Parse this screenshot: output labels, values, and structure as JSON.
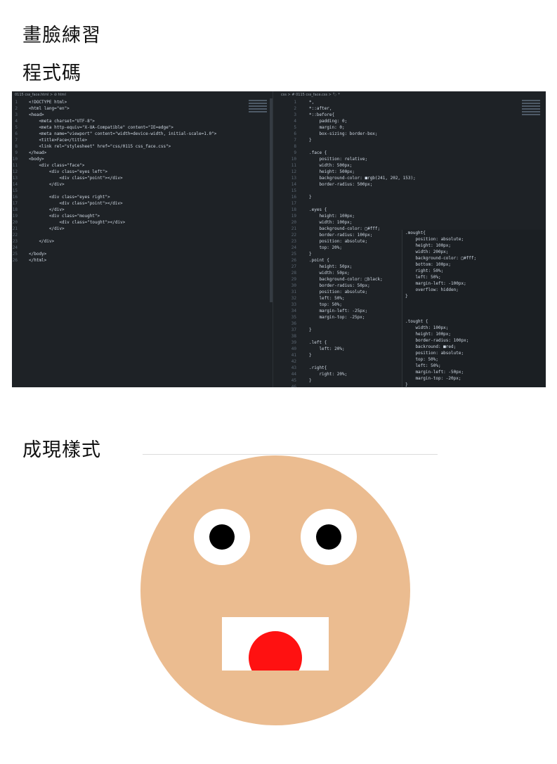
{
  "headings": {
    "practice": "畫臉練習",
    "code": "程式碼",
    "result": "成現樣式"
  },
  "editor": {
    "html_tab": "0115 css_face.html > ⊘ html",
    "css_tab": "css > # 0115 css_face.css > 🏷 *",
    "html_lines": [
      {
        "n": "1",
        "t": "<!DOCTYPE html>"
      },
      {
        "n": "2",
        "t": "<html lang=\"en\">"
      },
      {
        "n": "3",
        "t": "<head>"
      },
      {
        "n": "4",
        "t": "    <meta charset=\"UTF-8\">"
      },
      {
        "n": "5",
        "t": "    <meta http-equiv=\"X-UA-Compatible\" content=\"IE=edge\">"
      },
      {
        "n": "6",
        "t": "    <meta name=\"viewport\" content=\"width=device-width, initial-scale=1.0\">"
      },
      {
        "n": "7",
        "t": "    <title>Face</title>"
      },
      {
        "n": "8",
        "t": "    <link rel=\"stylesheet\" href=\"css/0115 css_face.css\">"
      },
      {
        "n": "9",
        "t": "</head>"
      },
      {
        "n": "10",
        "t": "<body>"
      },
      {
        "n": "11",
        "t": "    <div class=\"face\">"
      },
      {
        "n": "12",
        "t": "        <div class=\"eyes left\">"
      },
      {
        "n": "13",
        "t": "            <div class=\"point\"></div>"
      },
      {
        "n": "14",
        "t": "        </div>"
      },
      {
        "n": "15",
        "t": ""
      },
      {
        "n": "16",
        "t": "        <div class=\"eyes right\">"
      },
      {
        "n": "17",
        "t": "            <div class=\"point\"></div>"
      },
      {
        "n": "18",
        "t": "        </div>"
      },
      {
        "n": "19",
        "t": "        <div class=\"mought\">"
      },
      {
        "n": "20",
        "t": "            <div class=\"tought\"></div>"
      },
      {
        "n": "21",
        "t": "        </div>"
      },
      {
        "n": "22",
        "t": ""
      },
      {
        "n": "23",
        "t": "    </div>"
      },
      {
        "n": "24",
        "t": ""
      },
      {
        "n": "25",
        "t": "</body>"
      },
      {
        "n": "26",
        "t": "</html>"
      }
    ],
    "css_lines": [
      {
        "n": "1",
        "t": "*,"
      },
      {
        "n": "2",
        "t": "*::after,"
      },
      {
        "n": "3",
        "t": "*::before{"
      },
      {
        "n": "4",
        "t": "    padding: 0;"
      },
      {
        "n": "5",
        "t": "    margin: 0;"
      },
      {
        "n": "6",
        "t": "    box-sizing: border-box;"
      },
      {
        "n": "7",
        "t": "}"
      },
      {
        "n": "8",
        "t": ""
      },
      {
        "n": "9",
        "t": ".face {"
      },
      {
        "n": "10",
        "t": "    position: relative;"
      },
      {
        "n": "11",
        "t": "    width: 500px;"
      },
      {
        "n": "12",
        "t": "    height: 500px;"
      },
      {
        "n": "13",
        "t": "    background-color: ■rgb(241, 202, 153);"
      },
      {
        "n": "14",
        "t": "    border-radius: 500px;"
      },
      {
        "n": "15",
        "t": ""
      },
      {
        "n": "16",
        "t": "}"
      },
      {
        "n": "17",
        "t": ""
      },
      {
        "n": "18",
        "t": ".eyes {"
      },
      {
        "n": "19",
        "t": "    height: 100px;"
      },
      {
        "n": "20",
        "t": "    width: 100px;"
      },
      {
        "n": "21",
        "t": "    background-color: □#fff;"
      },
      {
        "n": "22",
        "t": "    border-radius: 100px;"
      },
      {
        "n": "23",
        "t": "    position: absolute;"
      },
      {
        "n": "24",
        "t": "    top: 20%;"
      },
      {
        "n": "25",
        "t": "}"
      },
      {
        "n": "26",
        "t": ".point {"
      },
      {
        "n": "27",
        "t": "    height: 50px;"
      },
      {
        "n": "28",
        "t": "    width: 50px;"
      },
      {
        "n": "29",
        "t": "    background-color: □black;"
      },
      {
        "n": "30",
        "t": "    border-radius: 50px;"
      },
      {
        "n": "31",
        "t": "    position: absolute;"
      },
      {
        "n": "32",
        "t": "    left: 50%;"
      },
      {
        "n": "33",
        "t": "    top: 50%;"
      },
      {
        "n": "34",
        "t": "    margin-left: -25px;"
      },
      {
        "n": "35",
        "t": "    margin-top: -25px;"
      },
      {
        "n": "36",
        "t": ""
      },
      {
        "n": "37",
        "t": "}"
      },
      {
        "n": "38",
        "t": ""
      },
      {
        "n": "39",
        "t": ".left {"
      },
      {
        "n": "40",
        "t": "    left: 20%;"
      },
      {
        "n": "41",
        "t": "}"
      },
      {
        "n": "42",
        "t": ""
      },
      {
        "n": "43",
        "t": ".right{"
      },
      {
        "n": "44",
        "t": "    right: 20%;"
      },
      {
        "n": "45",
        "t": "}"
      },
      {
        "n": "46",
        "t": ""
      }
    ],
    "mought_lines": [
      ".mought{",
      "    position: absolute;",
      "    height: 100px;",
      "    width: 200px;",
      "    background-color: □#fff;",
      "    bottom: 100px;",
      "    right: 50%;",
      "    left: 50%;",
      "    margin-left: -100px;",
      "    overflow: hidden;",
      "}",
      "",
      "",
      "",
      ".tought {",
      "    width: 100px;",
      "    height: 100px;",
      "    border-radius: 100px;",
      "    backround: ■red;",
      "    position: absolute;",
      "    top: 50%;",
      "    left: 50%;",
      "    margin-left: -50px;",
      "    margin-top: -20px;",
      "}"
    ]
  },
  "colors": {
    "face": "#ebbc90",
    "eye": "#ffffff",
    "pupil": "#000000",
    "mouth": "#ffffff",
    "tongue": "#ff1111",
    "editor_bg": "#1e2226"
  }
}
